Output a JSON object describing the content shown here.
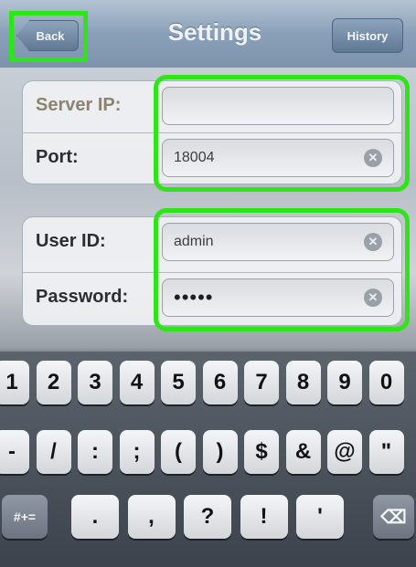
{
  "nav": {
    "title": "Settings",
    "back_label": "Back",
    "history_label": "History"
  },
  "server_group": {
    "server_ip": {
      "label": "Server IP:",
      "value": ""
    },
    "port": {
      "label": "Port:",
      "value": "18004"
    }
  },
  "user_group": {
    "user_id": {
      "label": "User ID:",
      "value": "admin"
    },
    "password": {
      "label": "Password:",
      "value": "•••••"
    }
  },
  "keyboard": {
    "row1": [
      "1",
      "2",
      "3",
      "4",
      "5",
      "6",
      "7",
      "8",
      "9",
      "0"
    ],
    "row2": [
      "-",
      "/",
      ":",
      ";",
      "(",
      ")",
      "$",
      "&",
      "@",
      "\""
    ],
    "row3": [
      ".",
      ",",
      "?",
      "!",
      "'"
    ],
    "symbols_label": "#+=",
    "backspace_icon": "backspace-icon"
  },
  "colors": {
    "highlight": "#2ee51a"
  }
}
